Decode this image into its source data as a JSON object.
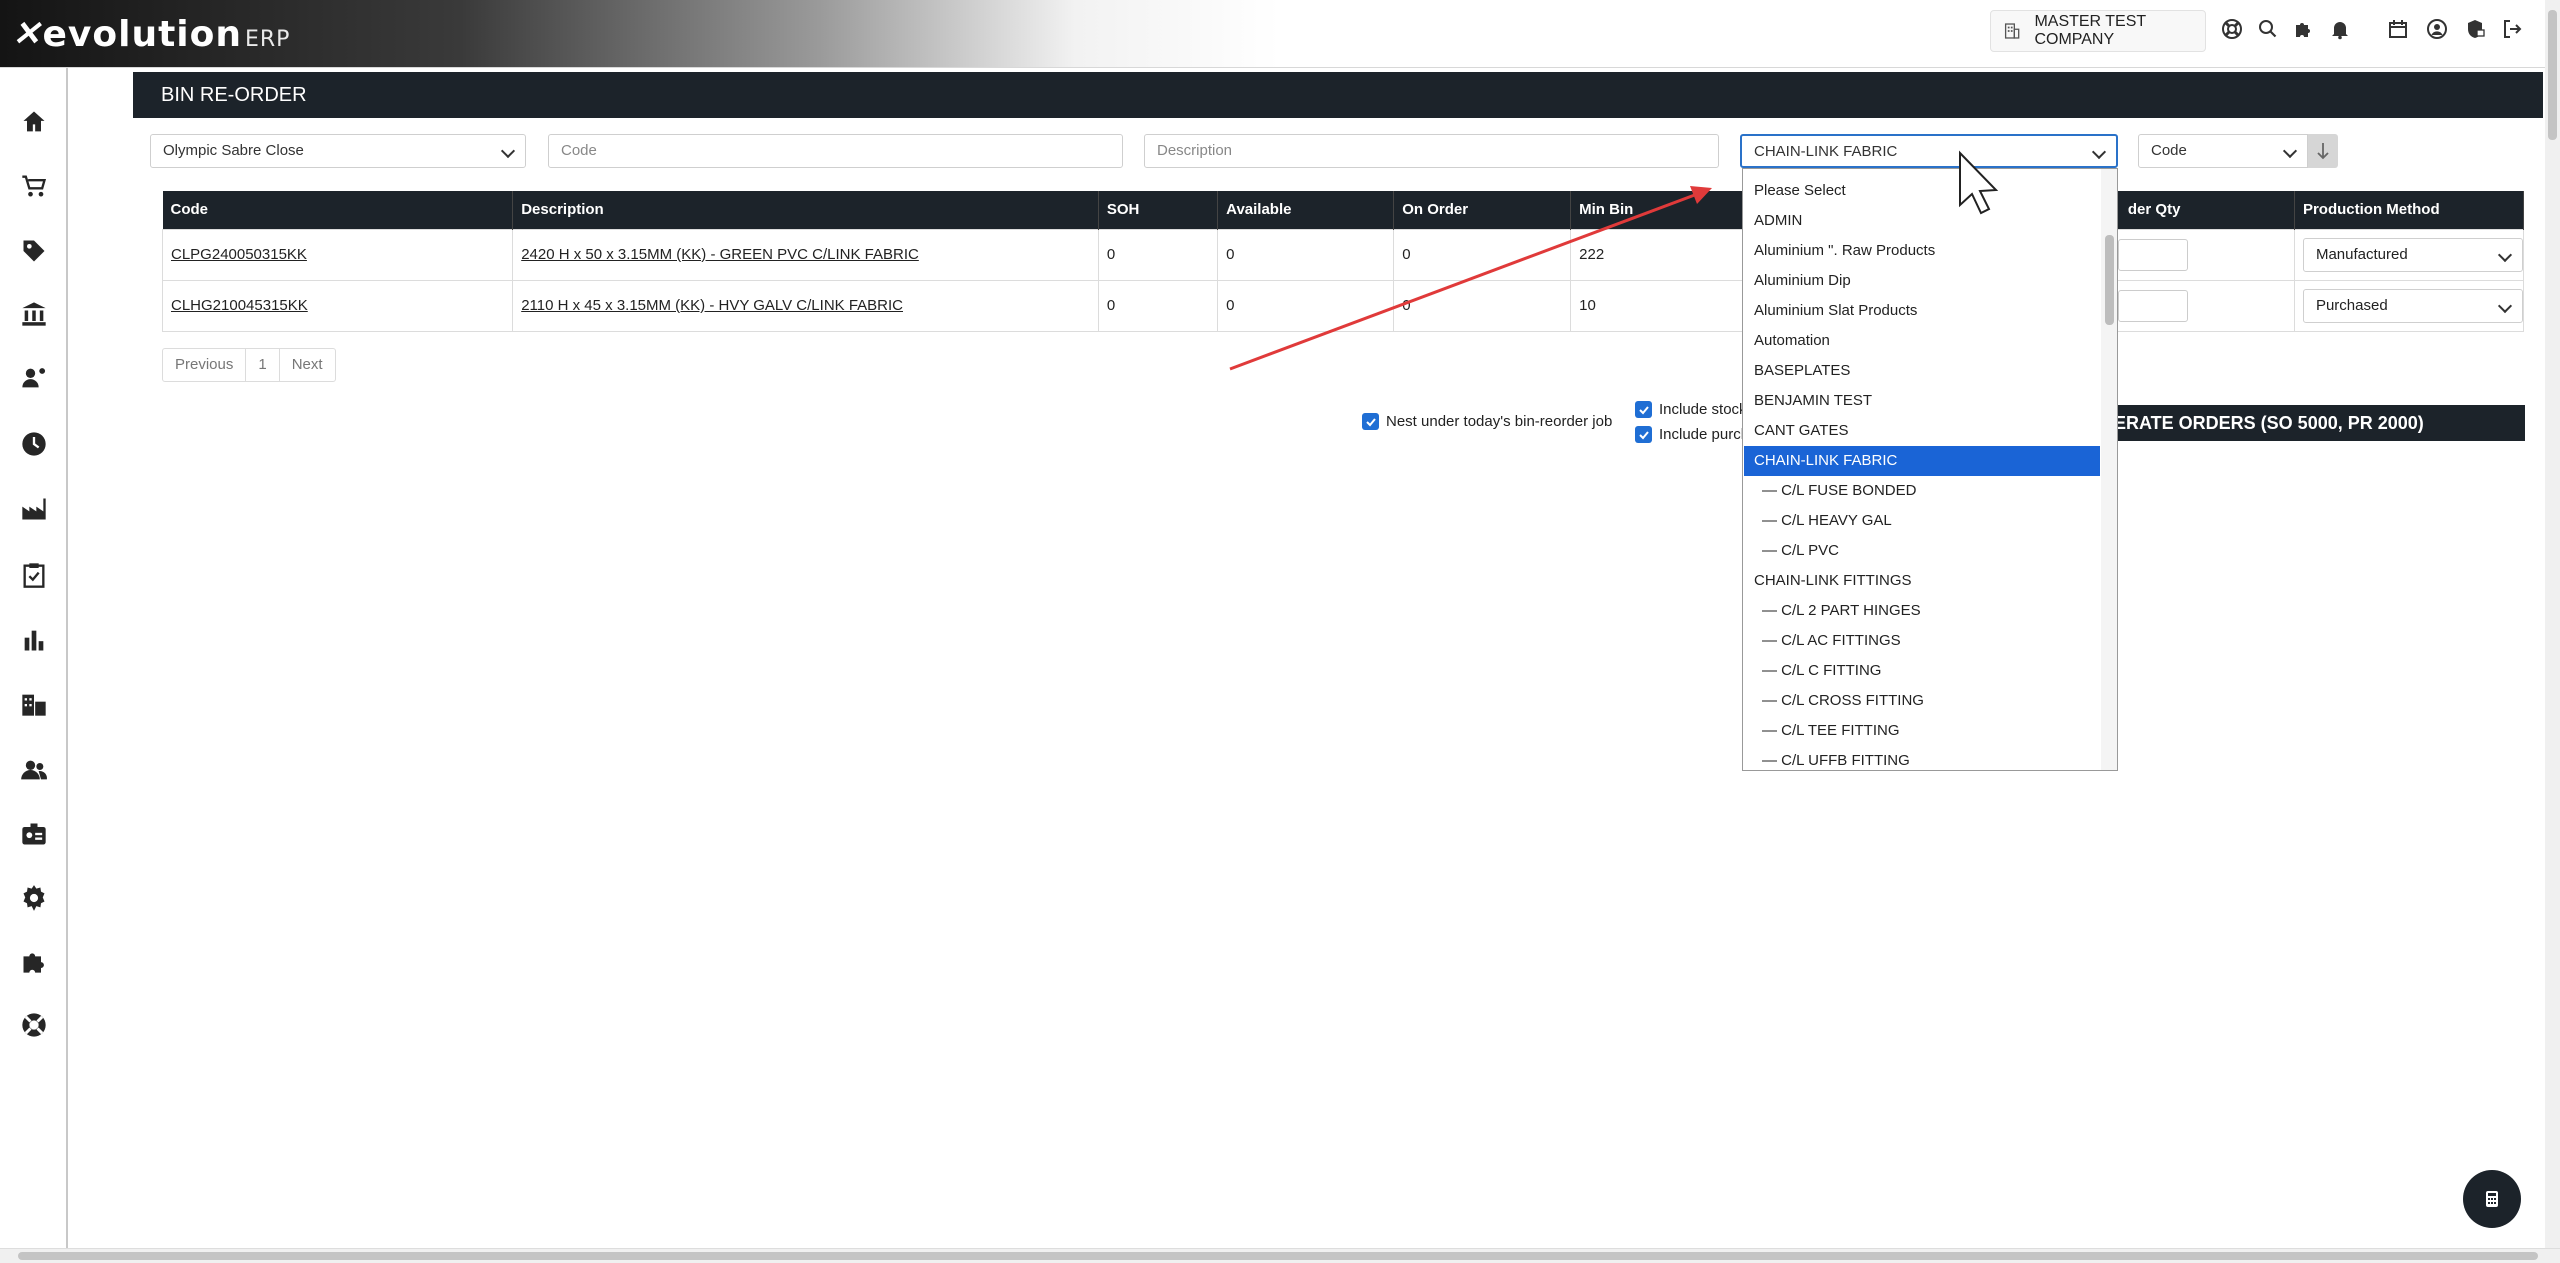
{
  "brand": {
    "name": "evolution",
    "suffix": "ERP"
  },
  "header": {
    "company": "MASTER TEST COMPANY"
  },
  "page_title": "BIN RE-ORDER",
  "filters": {
    "site": "Olympic Sabre Close",
    "code_placeholder": "Code",
    "description_placeholder": "Description",
    "category": "CHAIN-LINK FABRIC",
    "sort": "Code"
  },
  "table": {
    "headers": [
      "Code",
      "Description",
      "SOH",
      "Available",
      "On Order",
      "Min Bin",
      "der Qty",
      "Production Method"
    ],
    "rows": [
      {
        "code": "CLPG240050315KK",
        "description": "2420 H x 50 x 3.15MM (KK) - GREEN PVC C/LINK FABRIC",
        "soh": "0",
        "available": "0",
        "on_order": "0",
        "min_bin": "222",
        "method": "Manufactured"
      },
      {
        "code": "CLHG210045315KK",
        "description": "2110 H x 45 x 3.15MM (KK) - HVY GALV C/LINK FABRIC",
        "soh": "0",
        "available": "0",
        "on_order": "0",
        "min_bin": "10",
        "method": "Purchased"
      }
    ]
  },
  "pagination": {
    "previous": "Previous",
    "page": "1",
    "next": "Next"
  },
  "options": {
    "nest": "Nest under today's bin-reorder job",
    "include_stock": "Include stock",
    "include_purch": "Include purch"
  },
  "generate_button": "ERATE ORDERS (SO 5000, PR 2000)",
  "dropdown_options": [
    "Please Select",
    "ADMIN",
    "Aluminium \". Raw Products",
    "Aluminium Dip",
    "Aluminium Slat Products",
    "Automation",
    "BASEPLATES",
    "BENJAMIN TEST",
    "CANT GATES",
    "CHAIN-LINK FABRIC",
    "— C/L FUSE BONDED",
    "— C/L HEAVY GAL",
    "— C/L PVC",
    "CHAIN-LINK FITTINGS",
    "— C/L 2 PART HINGES",
    "— C/L AC FITTINGS",
    "— C/L C FITTING",
    "— C/L CROSS FITTING",
    "— C/L TEE FITTING",
    "— C/L UFFB FITTING"
  ],
  "dropdown_selected_index": 9,
  "colors": {
    "dark": "#1c232a",
    "accent": "#1a64d6",
    "arrow": "#e03a3a"
  },
  "sidebar_icons": [
    "home-icon",
    "cart-icon",
    "tag-icon",
    "bank-icon",
    "user-cog-icon",
    "clock-icon",
    "factory-icon",
    "clipboard-check-icon",
    "bar-chart-icon",
    "buildings-icon",
    "users-icon",
    "id-badge-icon",
    "gear-icon",
    "puzzle-icon",
    "lifebuoy-icon"
  ]
}
